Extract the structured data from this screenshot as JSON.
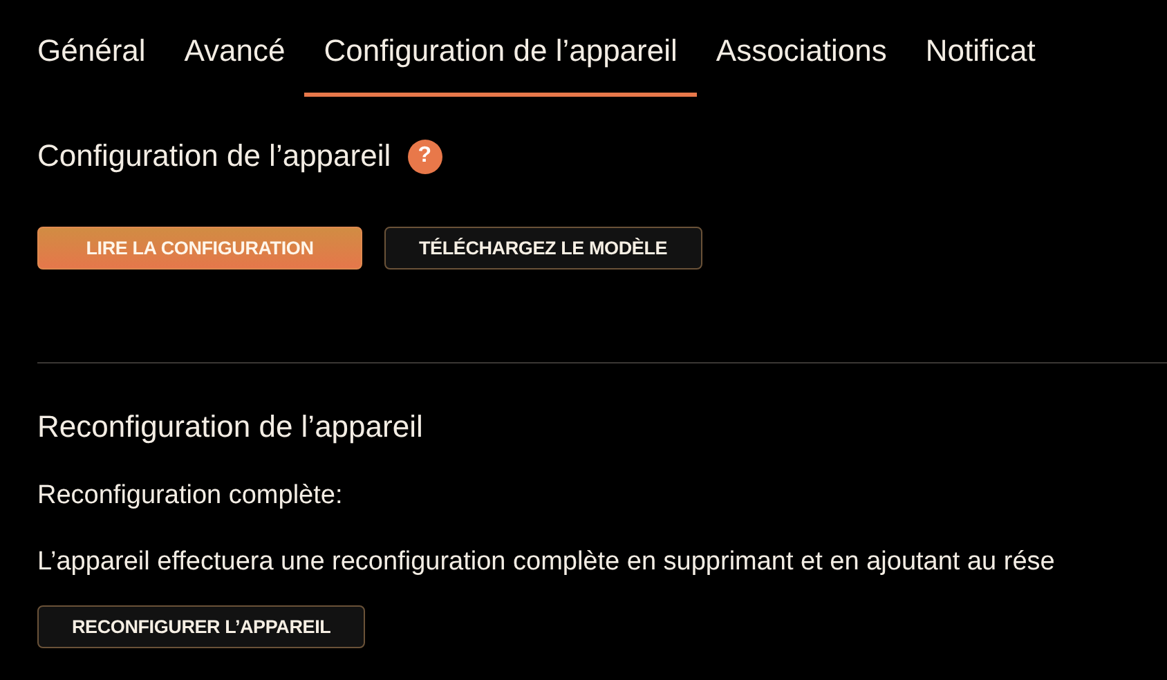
{
  "tabs": [
    {
      "label": "Général",
      "selected": false
    },
    {
      "label": "Avancé",
      "selected": false
    },
    {
      "label": "Configuration de l’appareil",
      "selected": true
    },
    {
      "label": "Associations",
      "selected": false
    },
    {
      "label": "Notificat",
      "selected": false
    }
  ],
  "config_section": {
    "title": "Configuration de l’appareil",
    "help_icon": "?",
    "buttons": [
      {
        "label": "LIRE LA CONFIGURATION",
        "kind": "primary"
      },
      {
        "label": "TÉLÉCHARGEZ LE MODÈLE",
        "kind": "secondary"
      }
    ]
  },
  "reconfig_section": {
    "title": "Reconfiguration de l’appareil",
    "label": "Reconfiguration complète:",
    "description": "L’appareil effectuera une reconfiguration complète en supprimant et en ajoutant au rése",
    "buttons": [
      {
        "label": "RECONFIGURER L’APPAREIL",
        "kind": "secondary"
      }
    ]
  }
}
